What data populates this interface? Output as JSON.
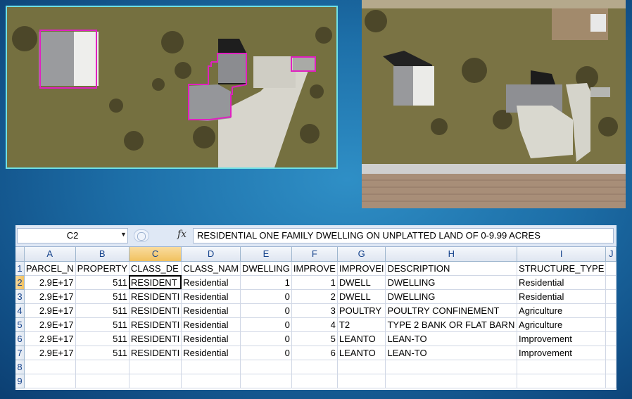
{
  "spreadsheet": {
    "name_box": "C2",
    "fx_label": "fx",
    "formula": "RESIDENTIAL ONE FAMILY DWELLING ON UNPLATTED LAND OF 0-9.99 ACRES",
    "columns": [
      "A",
      "B",
      "C",
      "D",
      "E",
      "F",
      "G",
      "H",
      "I",
      "J"
    ],
    "selected_column": "C",
    "selected_row": "2",
    "rows": [
      {
        "n": "1",
        "cells": [
          "PARCEL_N",
          "PROPERTY",
          "CLASS_DE",
          "CLASS_NAM",
          "DWELLING",
          "IMPROVE",
          "IMPROVEI",
          "DESCRIPTION",
          "STRUCTURE_TYPE",
          ""
        ]
      },
      {
        "n": "2",
        "cells": [
          "2.9E+17",
          "511",
          "RESIDENT",
          "Residential",
          "1",
          "1",
          "DWELL",
          "DWELLING",
          "Residential",
          ""
        ]
      },
      {
        "n": "3",
        "cells": [
          "2.9E+17",
          "511",
          "RESIDENTI",
          "Residential",
          "0",
          "2",
          "DWELL",
          "DWELLING",
          "Residential",
          ""
        ]
      },
      {
        "n": "4",
        "cells": [
          "2.9E+17",
          "511",
          "RESIDENTI",
          "Residential",
          "0",
          "3",
          "POULTRY",
          "POULTRY CONFINEMENT",
          "Agriculture",
          ""
        ]
      },
      {
        "n": "5",
        "cells": [
          "2.9E+17",
          "511",
          "RESIDENTI",
          "Residential",
          "0",
          "4",
          "T2",
          "TYPE 2 BANK OR FLAT BARN",
          "Agriculture",
          ""
        ]
      },
      {
        "n": "6",
        "cells": [
          "2.9E+17",
          "511",
          "RESIDENTI",
          "Residential",
          "0",
          "5",
          "LEANTO",
          "LEAN-TO",
          "Improvement",
          ""
        ]
      },
      {
        "n": "7",
        "cells": [
          "2.9E+17",
          "511",
          "RESIDENTI",
          "Residential",
          "0",
          "6",
          "LEANTO",
          "LEAN-TO",
          "Improvement",
          ""
        ]
      },
      {
        "n": "8",
        "cells": [
          "",
          "",
          "",
          "",
          "",
          "",
          "",
          "",
          "",
          ""
        ]
      },
      {
        "n": "9",
        "cells": [
          "",
          "",
          "",
          "",
          "",
          "",
          "",
          "",
          "",
          ""
        ]
      }
    ]
  },
  "colors": {
    "highlight_outline": "#e020c0",
    "accent": "#6ee0e6"
  }
}
